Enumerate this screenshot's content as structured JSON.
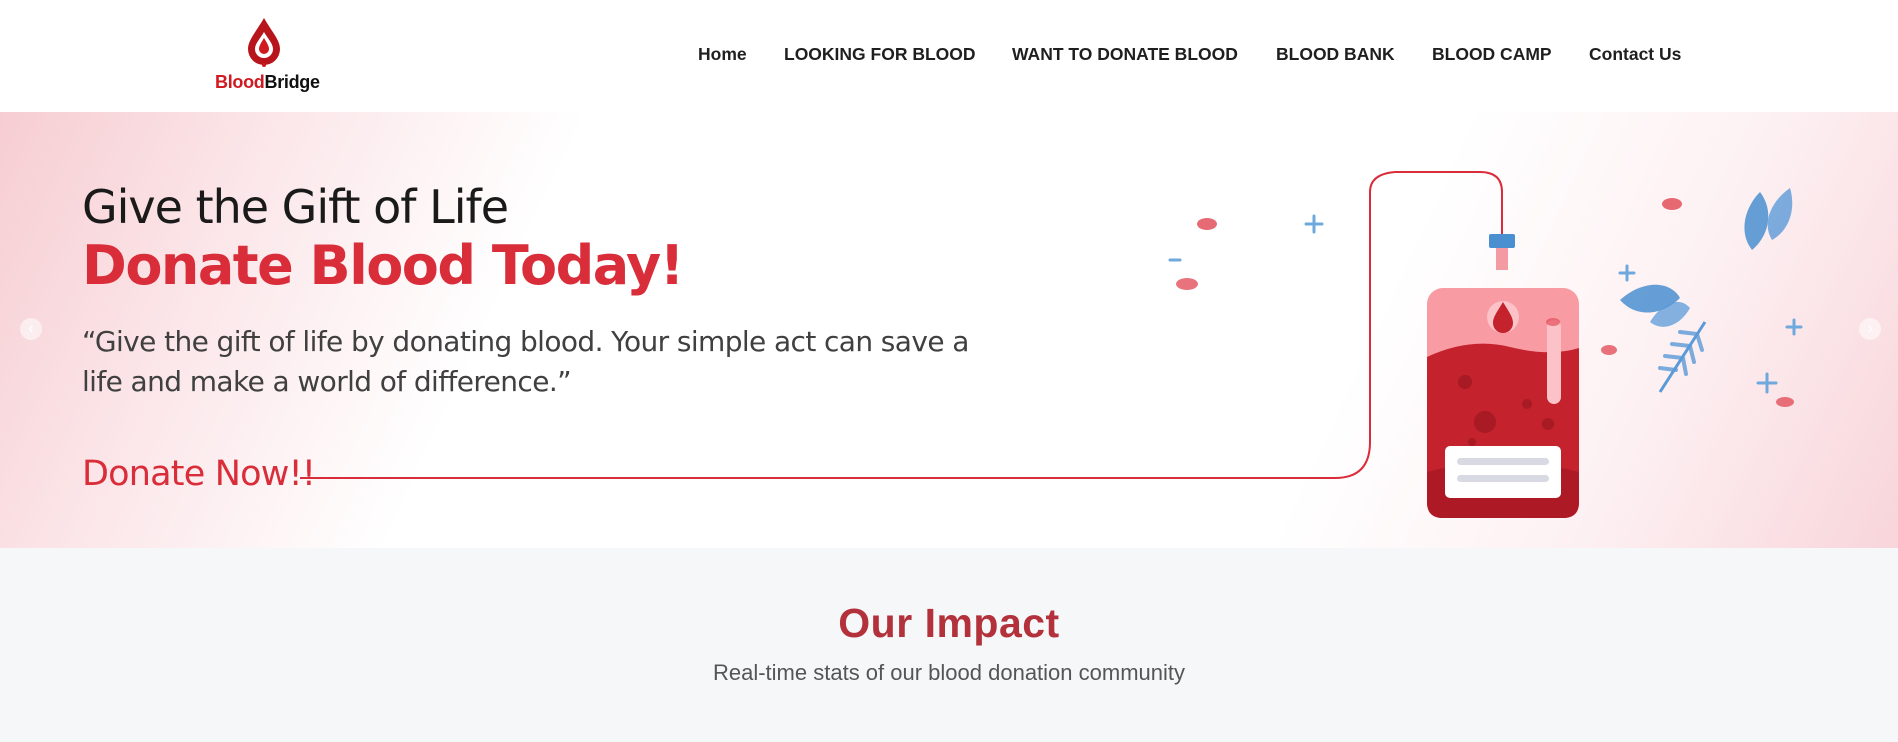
{
  "brand": {
    "name_part1": "Blood",
    "name_part2": "Bridge",
    "primary_color": "#d01920"
  },
  "nav": {
    "items": [
      {
        "label": "Home"
      },
      {
        "label": "LOOKING FOR BLOOD"
      },
      {
        "label": "WANT TO DONATE BLOOD"
      },
      {
        "label": "BLOOD BANK"
      },
      {
        "label": "BLOOD CAMP"
      },
      {
        "label": "Contact Us"
      }
    ]
  },
  "hero": {
    "line1": "Give the Gift of Life",
    "line2": "Donate Blood Today!",
    "quote": "“Give the gift of life by donating blood. Your simple act can save a life and make a world of difference.”",
    "cta": "Donate Now!!",
    "accent_color": "#d92d3a",
    "prev_icon": "chevron-left-icon",
    "next_icon": "chevron-right-icon"
  },
  "impact": {
    "title": "Our Impact",
    "subtitle": "Real-time stats of our blood donation community",
    "title_color": "#b3313a"
  }
}
